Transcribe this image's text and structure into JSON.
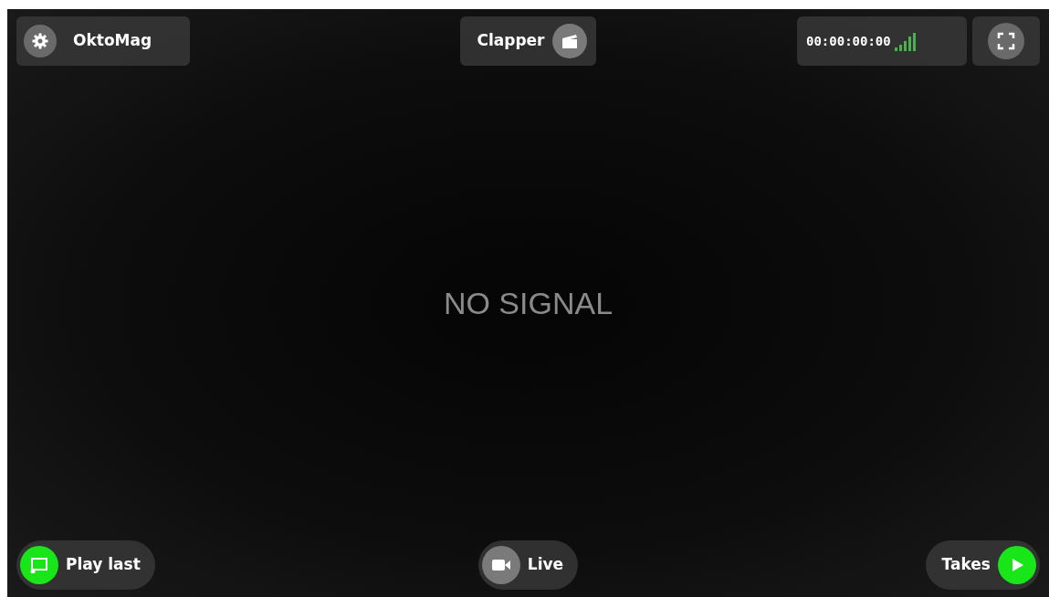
{
  "top_bar": {
    "settings_button": {
      "label": "OktoMag"
    },
    "clapper_button": {
      "label": "Clapper"
    },
    "timecode": "00:00:00:00"
  },
  "video": {
    "message": "NO SIGNAL"
  },
  "bottom_bar": [
    {
      "kind": "play",
      "label": "Play last",
      "active": true
    },
    {
      "kind": "live",
      "label": "Live",
      "active": false
    },
    {
      "kind": "takes",
      "label": "Takes",
      "active": true
    }
  ]
}
